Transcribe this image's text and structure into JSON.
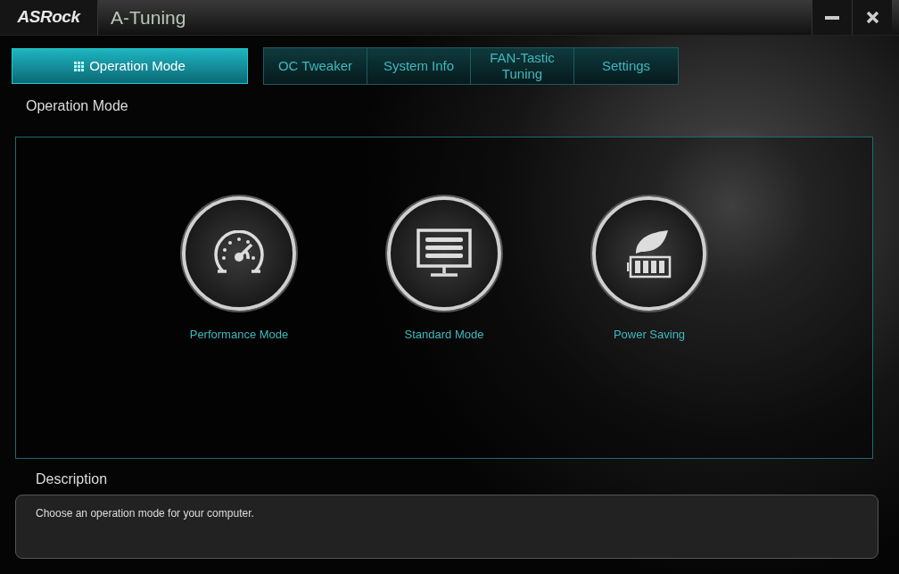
{
  "window": {
    "logo": "ASRock",
    "title": "A-Tuning"
  },
  "tabs": [
    {
      "label": "Operation Mode",
      "selected": true
    },
    {
      "label": "OC Tweaker",
      "selected": false
    },
    {
      "label": "System Info",
      "selected": false
    },
    {
      "label": "FAN-Tastic Tuning",
      "selected": false
    },
    {
      "label": "Settings",
      "selected": false
    }
  ],
  "section": {
    "title": "Operation Mode"
  },
  "modes": [
    {
      "kind": "gauge",
      "label": "Performance Mode"
    },
    {
      "kind": "monitor",
      "label": "Standard Mode"
    },
    {
      "kind": "leaf",
      "label": "Power Saving"
    }
  ],
  "description": {
    "title": "Description",
    "text": "Choose an operation mode for your computer."
  }
}
